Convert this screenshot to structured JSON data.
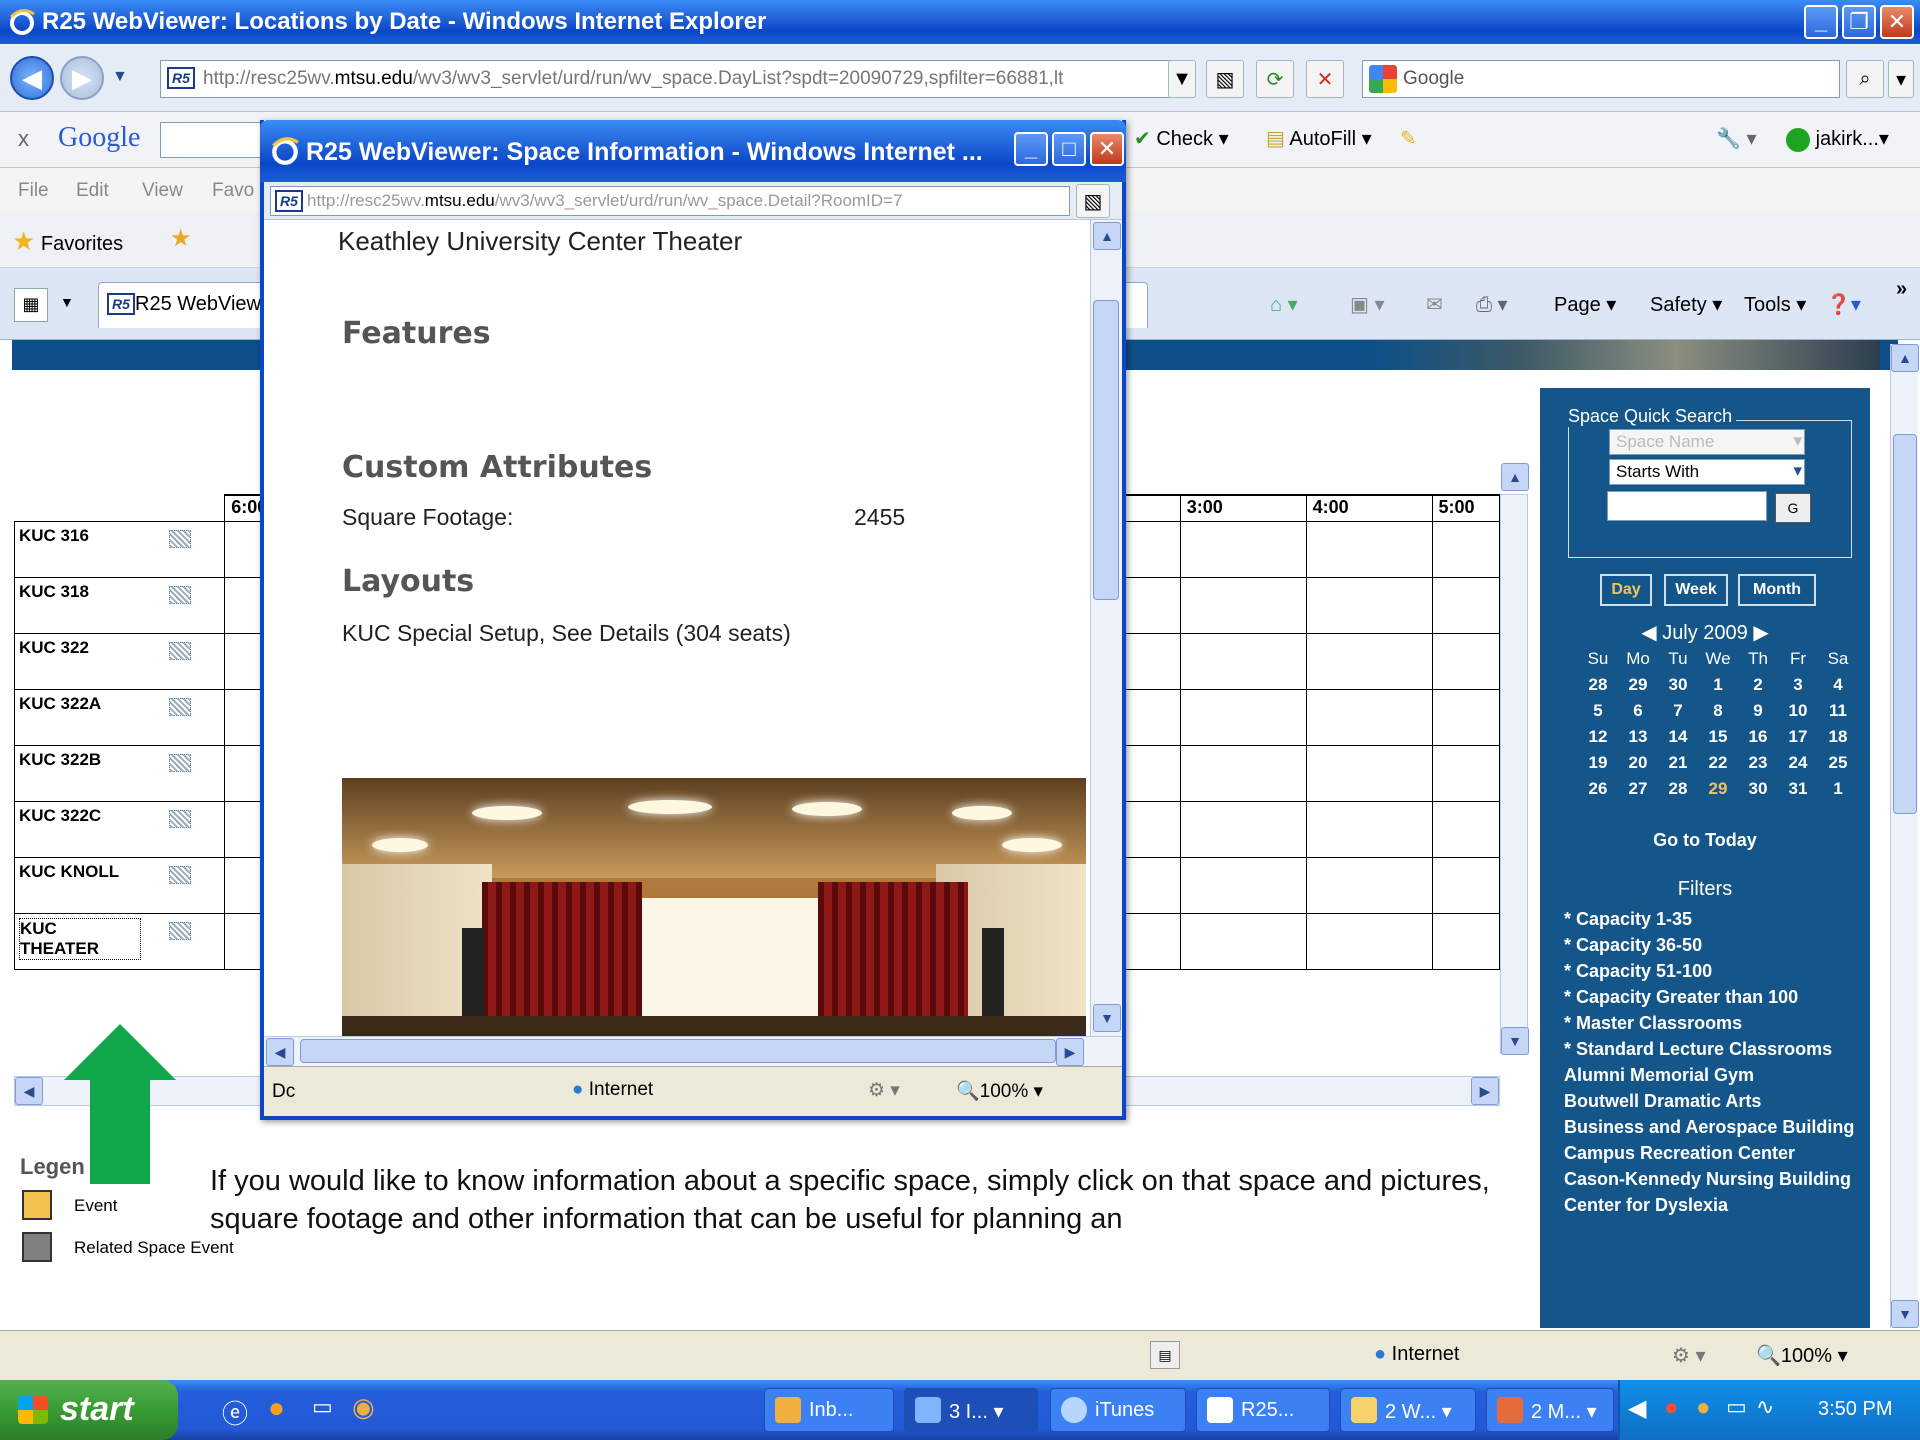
{
  "main_window": {
    "title": "R25 WebViewer: Locations by Date - Windows Internet Explorer",
    "url_domain_prefix": "http://resc25wv.",
    "url_domain": "mtsu.edu",
    "url_path": "/wv3/wv3_servlet/urd/run/wv_space.DayList?spdt=20090729,spfilter=66881,lt",
    "search_placeholder": "Google"
  },
  "google_toolbar": {
    "close": "x",
    "logo": "Google",
    "check": "Check",
    "autofill": "AutoFill",
    "user": "jakirk..."
  },
  "menu": [
    "File",
    "Edit",
    "View",
    "Favo"
  ],
  "favorites": {
    "label": "Favorites"
  },
  "tab": {
    "label": "R25 WebViewe"
  },
  "commands": {
    "page": "Page",
    "safety": "Safety",
    "tools": "Tools"
  },
  "schedule": {
    "time_headers": [
      "6:00",
      ":00",
      "3:00",
      "4:00",
      "5:00"
    ],
    "rooms": [
      "KUC 316",
      "KUC 318",
      "KUC 322",
      "KUC 322A",
      "KUC 322B",
      "KUC 322C",
      "KUC KNOLL",
      "KUC THEATER"
    ]
  },
  "legend": {
    "title": "Legen",
    "items": [
      {
        "label": "Event",
        "color": "#f2c14e"
      },
      {
        "label": "Related Space Event",
        "color": "#808080"
      }
    ]
  },
  "instruction": "If you would like to know information about a specific space, simply click on that space and pictures, square footage and other information  that  can be useful for planning an",
  "sidebar": {
    "quick_search": {
      "label": "Space Quick Search",
      "field_select": "Space Name",
      "match_select": "Starts With",
      "go": "G"
    },
    "view_buttons": [
      "Day",
      "Week",
      "Month"
    ],
    "month": "July 2009",
    "days_of_week": [
      "Su",
      "Mo",
      "Tu",
      "We",
      "Th",
      "Fr",
      "Sa"
    ],
    "weeks": [
      [
        "28",
        "29",
        "30",
        "1",
        "2",
        "3",
        "4"
      ],
      [
        "5",
        "6",
        "7",
        "8",
        "9",
        "10",
        "11"
      ],
      [
        "12",
        "13",
        "14",
        "15",
        "16",
        "17",
        "18"
      ],
      [
        "19",
        "20",
        "21",
        "22",
        "23",
        "24",
        "25"
      ],
      [
        "26",
        "27",
        "28",
        "29",
        "30",
        "31",
        "1"
      ]
    ],
    "today": "29",
    "go_to_today": "Go to Today",
    "filters_title": "Filters",
    "filters": [
      "* Capacity 1-35",
      "* Capacity 36-50",
      "* Capacity 51-100",
      "* Capacity Greater than 100",
      "* Master Classrooms",
      "* Standard Lecture Classrooms",
      "Alumni Memorial Gym",
      "Boutwell Dramatic Arts",
      "Business and Aerospace Building",
      "Campus Recreation Center",
      "Cason-Kennedy Nursing Building",
      "Center for Dyslexia"
    ]
  },
  "popup": {
    "title": "R25 WebViewer: Space Information - Windows Internet ...",
    "url_domain_prefix": "http://resc25wv.",
    "url_domain": "mtsu.edu",
    "url_path": "/wv3/wv3_servlet/urd/run/wv_space.Detail?RoomID=7",
    "room_name": "Keathley University Center Theater",
    "features_heading": "Features",
    "custom_attributes_heading": "Custom Attributes",
    "square_footage_label": "Square Footage:",
    "square_footage_value": "2455",
    "layouts_heading": "Layouts",
    "layout": "KUC Special Setup, See Details (304 seats)",
    "status_left": "Dc",
    "status_zone": "Internet",
    "status_zoom": "100%"
  },
  "statusbar": {
    "zone": "Internet",
    "zoom": "100%"
  },
  "taskbar": {
    "start": "start",
    "tasks": [
      "Inb...",
      "3 I...",
      "iTunes",
      "R25...",
      "2 W...",
      "2 M..."
    ],
    "time": "3:50 PM"
  }
}
